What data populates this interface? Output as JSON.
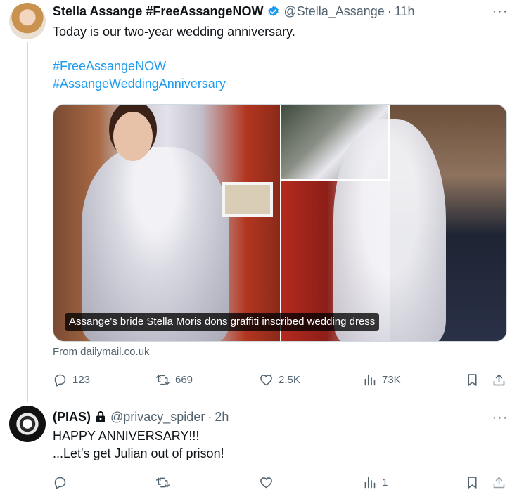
{
  "tweets": [
    {
      "name": "Stella Assange #FreeAssangeNOW",
      "handle": "@Stella_Assange",
      "separator": "·",
      "time": "11h",
      "text_line1": "Today is our two-year wedding anniversary.",
      "hashtags": [
        "#FreeAssangeNOW",
        "#AssangeWeddingAnniversary"
      ],
      "media_caption": "Assange's bride Stella Moris dons graffiti inscribed wedding dress",
      "source": "From dailymail.co.uk",
      "stats": {
        "replies": "123",
        "retweets": "669",
        "likes": "2.5K",
        "views": "73K"
      },
      "icons": [
        "avatar",
        "verified-badge-icon",
        "more-icon",
        "reply-icon",
        "retweet-icon",
        "like-icon",
        "views-icon",
        "bookmark-icon",
        "share-icon"
      ]
    },
    {
      "name": "(PIAS)",
      "handle": "@privacy_spider",
      "separator": "·",
      "time": "2h",
      "text_lines": [
        "HAPPY ANNIVERSARY!!!",
        "...Let's get Julian out of prison!"
      ],
      "stats": {
        "replies": "",
        "retweets": "",
        "likes": "",
        "views": "1"
      },
      "icons": [
        "avatar",
        "lock-icon",
        "more-icon",
        "reply-icon",
        "retweet-icon",
        "like-icon",
        "views-icon",
        "bookmark-icon",
        "share-icon"
      ]
    }
  ],
  "colors": {
    "text": "#0f1419",
    "secondary": "#536471",
    "link": "#1d9bf0",
    "verified": "#1d9bf0",
    "border": "#cfd9de"
  }
}
